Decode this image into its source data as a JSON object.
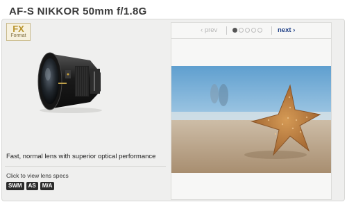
{
  "product": {
    "title": "AF-S NIKKOR 50mm f/1.8G",
    "format_badge": {
      "line1": "FX",
      "line2": "Format"
    },
    "tagline": "Fast, normal lens with superior optical performance",
    "specs_link": "Click to view lens specs",
    "feature_badges": [
      "SWM",
      "AS",
      "M/A"
    ]
  },
  "gallery": {
    "prev_label": "prev",
    "next_label": "next",
    "page_count": 5,
    "current_page": 1,
    "image_description": "starfish"
  },
  "colors": {
    "title": "#3a3a3a",
    "next_link": "#1e3f86",
    "fx_badge": "#b8932c",
    "badge_bg": "#2b2b2b"
  }
}
